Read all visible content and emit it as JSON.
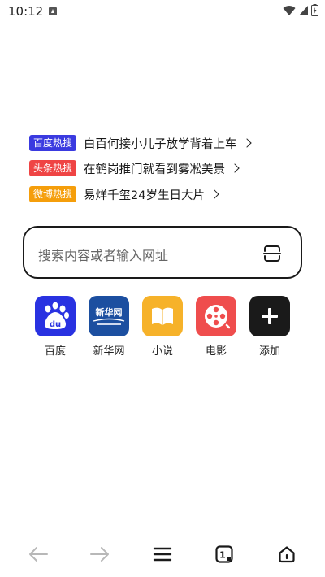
{
  "status_bar": {
    "time": "10:12",
    "icons": [
      "notification-a-icon",
      "wifi-icon",
      "signal-icon",
      "battery-icon"
    ]
  },
  "hot_searches": [
    {
      "badge": "百度热搜",
      "badge_color": "#3a3ae0",
      "text": "白百何接小儿子放学背着上车"
    },
    {
      "badge": "头条热搜",
      "badge_color": "#ef4444",
      "text": "在鹤岗推门就看到雾凇美景"
    },
    {
      "badge": "微博热搜",
      "badge_color": "#f59e0b",
      "text": "易烊千玺24岁生日大片"
    }
  ],
  "search": {
    "placeholder": "搜索内容或者输入网址",
    "scan_icon": "scan-icon"
  },
  "shortcuts": [
    {
      "label": "百度",
      "icon": "baidu-paw-icon",
      "color": "#2932e1",
      "tile_text": "du"
    },
    {
      "label": "新华网",
      "icon": "xinhua-logo-icon",
      "color": "#1c4fa0",
      "tile_text": "新华网"
    },
    {
      "label": "小说",
      "icon": "book-icon",
      "color": "#f6b22a"
    },
    {
      "label": "电影",
      "icon": "film-reel-icon",
      "color": "#ef4d4d"
    },
    {
      "label": "添加",
      "icon": "plus-icon",
      "color": "#1a1a1a"
    }
  ],
  "bottom_nav": {
    "items": [
      "back-arrow-icon",
      "forward-arrow-icon",
      "menu-icon",
      "tabs-icon",
      "home-icon"
    ],
    "tab_count": "1"
  }
}
